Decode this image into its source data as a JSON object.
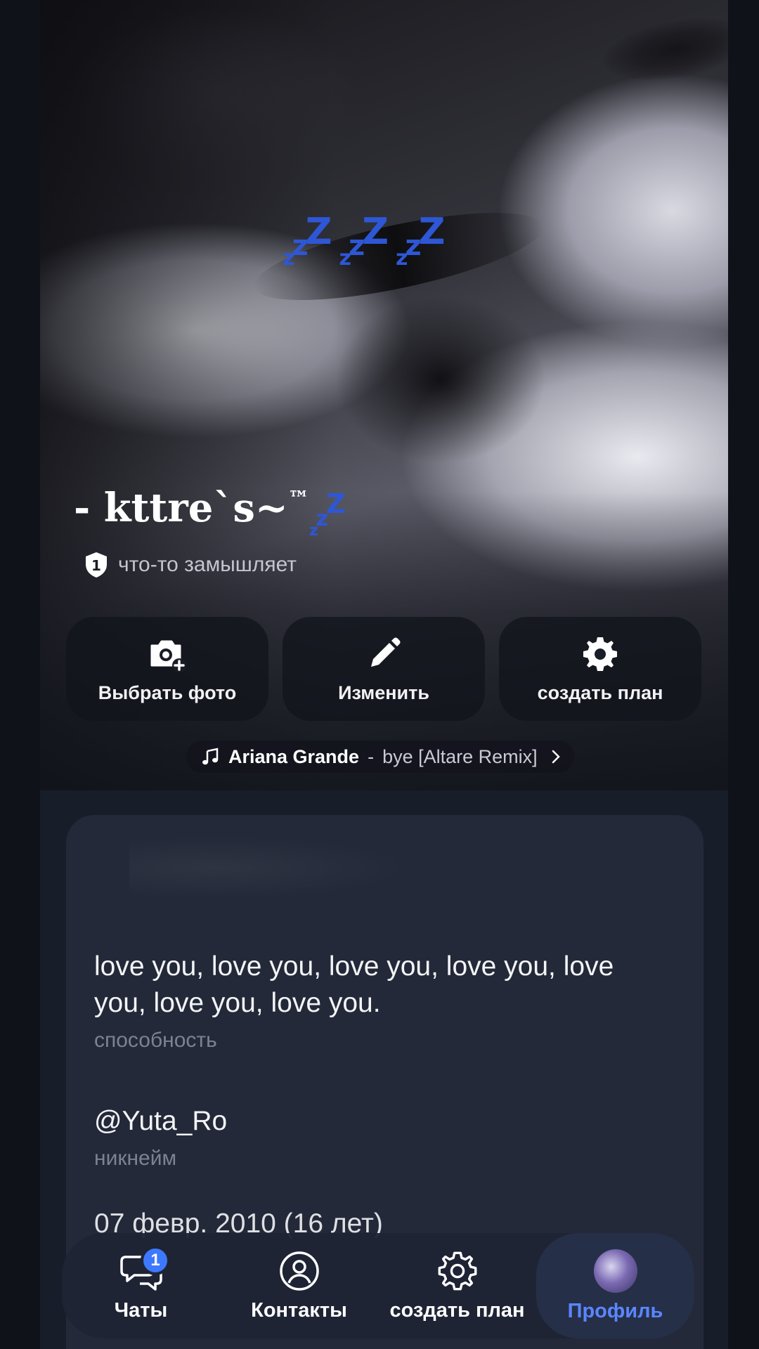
{
  "profile": {
    "name": "- kttre`s~",
    "name_suffix": "™",
    "name_zz": "zzZ",
    "cover_zzz": "zzZ zzZ zzZ",
    "status_text": "что-то замышляет"
  },
  "actions": [
    {
      "label": "Выбрать фото",
      "icon": "camera-add-icon"
    },
    {
      "label": "Изменить",
      "icon": "pencil-icon"
    },
    {
      "label": "создать план",
      "icon": "gear-icon"
    }
  ],
  "music": {
    "artist": "Ariana Grande",
    "separator": " - ",
    "track": "bye [Altare Remix]"
  },
  "info": {
    "about_value": "love you, love you, love you, love you, love you, love you, love you.",
    "about_label": "способность",
    "nickname_value": "@Yuta_Ro",
    "nickname_label": "никнейм",
    "birthday_value": "07 февр. 2010 (16 лет)"
  },
  "nav": {
    "chats_label": "Чаты",
    "chats_badge": "1",
    "contacts_label": "Контакты",
    "plan_label": "создать план",
    "profile_label": "Профиль"
  },
  "colors": {
    "accent": "#5a86ff",
    "badge": "#3e78ff",
    "zzz": "#2e57d6",
    "card": "#232938"
  }
}
